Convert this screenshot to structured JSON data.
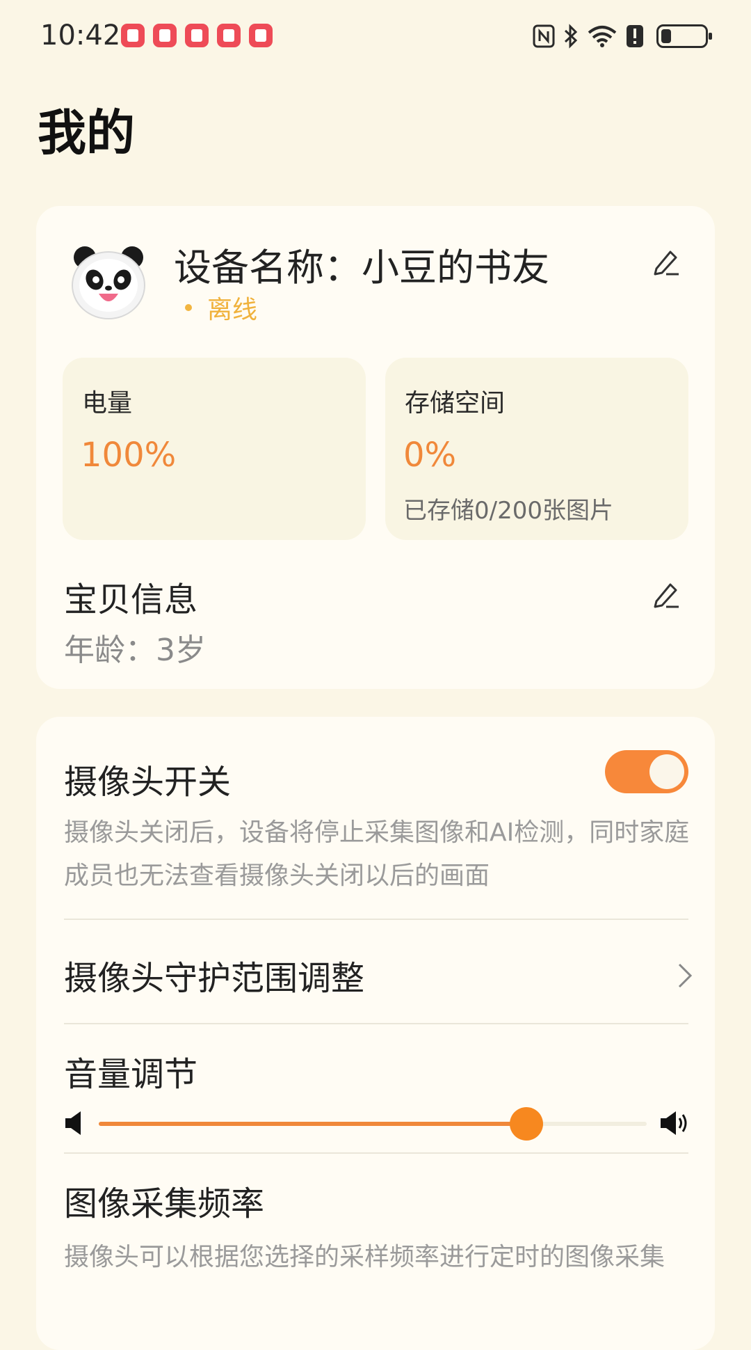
{
  "status_bar": {
    "time": "10:42",
    "notification_icons": [
      "notification-app-icon",
      "notification-app-icon",
      "notification-app-icon",
      "notification-app-icon",
      "notification-app-icon"
    ],
    "system_icons": [
      "nfc-icon",
      "bluetooth-icon",
      "wifi-icon",
      "alert-icon",
      "battery-icon"
    ]
  },
  "page": {
    "title": "我的"
  },
  "device": {
    "name": "设备名称：小豆的书友",
    "status": "离线",
    "status_color": "#F0B23C",
    "avatar_icon": "panda-avatar-icon",
    "edit_icon": "edit-icon"
  },
  "stats": {
    "battery": {
      "label": "电量",
      "value": "100%"
    },
    "storage": {
      "label": "存储空间",
      "value": "0%",
      "detail": "已存储0/200张图片"
    }
  },
  "baby": {
    "title": "宝贝信息",
    "age": "年龄：3岁"
  },
  "settings": {
    "camera_switch": {
      "title": "摄像头开关",
      "description": "摄像头关闭后，设备将停止采集图像和AI检测，同时家庭成员也无法查看摄像头关闭以后的画面",
      "enabled": true
    },
    "guard_range": {
      "title": "摄像头守护范围调整"
    },
    "volume": {
      "title": "音量调节",
      "level": 0.78
    },
    "capture_frequency": {
      "title": "图像采集频率",
      "description": "摄像头可以根据您选择的采样频率进行定时的图像采集"
    }
  },
  "colors": {
    "accent": "#F0883A",
    "background": "#FBF6E6",
    "card": "#FFFCF4"
  }
}
